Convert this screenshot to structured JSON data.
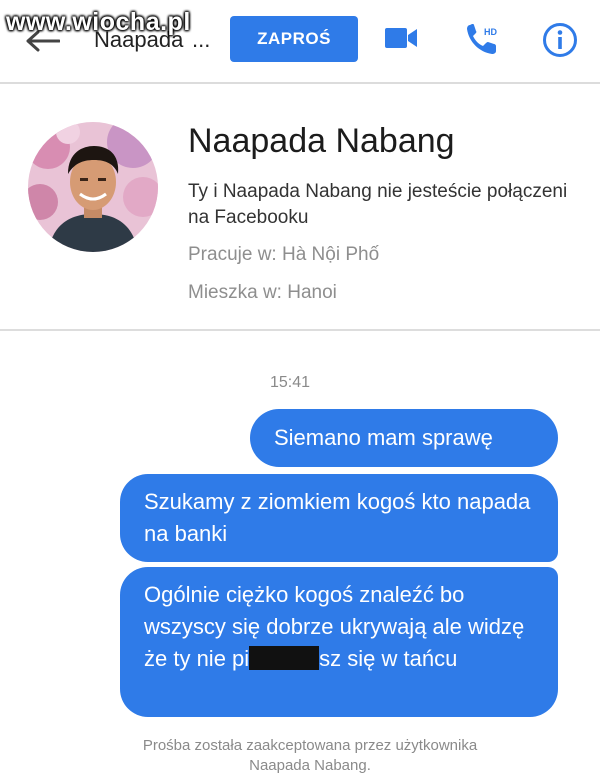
{
  "watermark": "www.wiocha.pl",
  "topbar": {
    "title": "Naapada",
    "ellipsis": "...",
    "invite_label": "ZAPROŚ",
    "icons": [
      "back-arrow-icon",
      "video-camera-icon",
      "hd-phone-icon",
      "info-icon"
    ],
    "accent_color": "#2f7be8"
  },
  "profile": {
    "name": "Naapada Nabang",
    "not_connected": "Ty i Naapada Nabang nie jesteście połączeni na Facebooku",
    "work": "Pracuje w: Hà Nội Phố",
    "city": "Mieszka w: Hanoi"
  },
  "chat": {
    "time": "15:41",
    "messages": [
      {
        "text": "Siemano mam sprawę"
      },
      {
        "text": "Szukamy z ziomkiem kogoś kto napada na banki"
      },
      {
        "text_before": "Ogólnie ciężko kogoś znaleźć bo wszyscy się dobrze ukrywają ale widzę że ty nie pi",
        "text_after": "sz się w tańcu"
      }
    ],
    "accepted_notice": "Prośba została zaakceptowana przez użytkownika Naapada Nabang."
  }
}
